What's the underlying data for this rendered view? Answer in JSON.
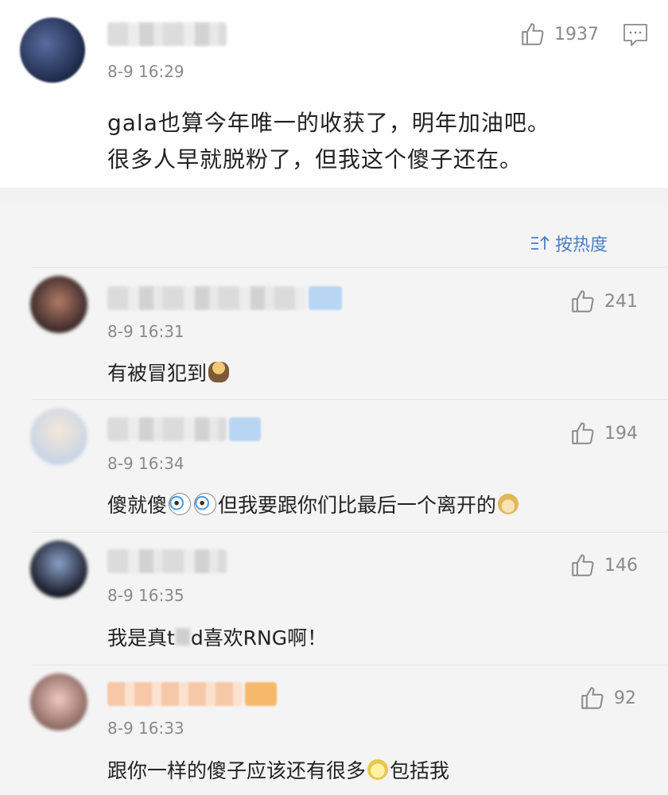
{
  "post": {
    "time": "8-9 16:29",
    "likes": "1937",
    "lines": [
      "gala也算今年唯一的收获了，明年加油吧。",
      "很多人早就脱粉了，但我这个傻子还在。"
    ]
  },
  "sort_label": "按热度",
  "comments": [
    {
      "time": "8-9 16:31",
      "likes": "241",
      "text_a": "有被冒犯到",
      "text_b": "",
      "text_c": ""
    },
    {
      "time": "8-9 16:34",
      "likes": "194",
      "text_a": "傻就傻",
      "text_b": " 但我要跟你们比最后一个离开的",
      "text_c": ""
    },
    {
      "time": "8-9 16:35",
      "likes": "146",
      "text_a": "我是真t",
      "text_b": "d喜欢RNG啊！",
      "text_c": ""
    },
    {
      "time": "8-9 16:33",
      "likes": "92",
      "text_a": "跟你一样的傻子应该还有很多",
      "text_b": "包括我",
      "text_c": ""
    }
  ],
  "icons": {
    "like": "thumbs-up-outline-icon",
    "reply": "comment-bubble-icon",
    "sort": "sort-arrows-icon"
  },
  "colors": {
    "link_blue": "#4a7fc1",
    "muted": "#8a8a8a",
    "page_bg": "#f4f4f4"
  }
}
